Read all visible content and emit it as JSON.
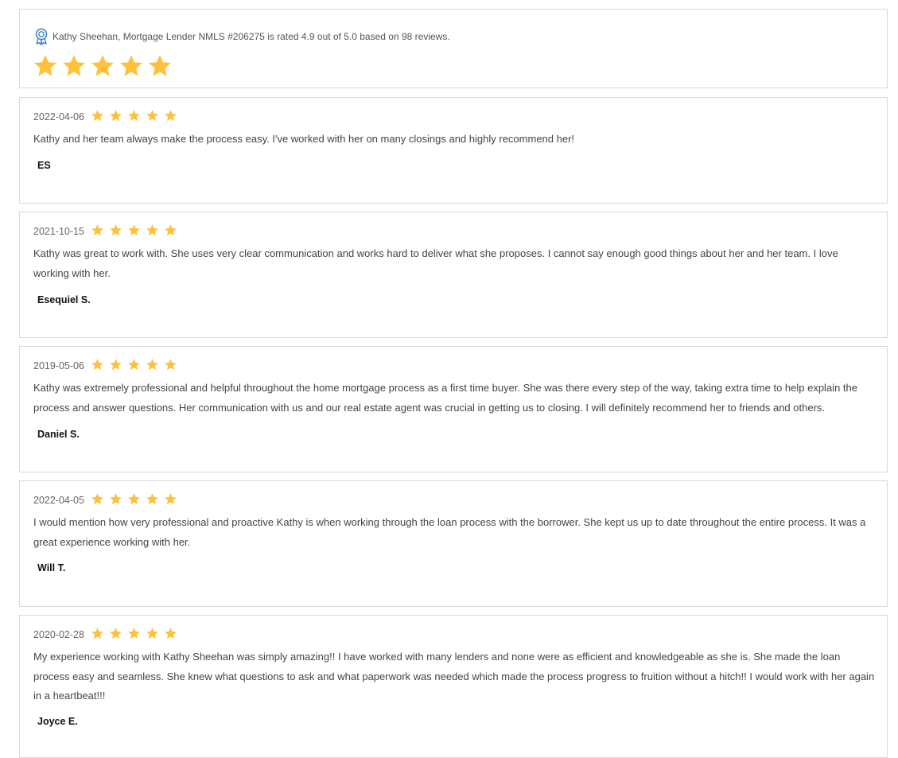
{
  "summary": {
    "text": "Kathy Sheehan, Mortgage Lender NMLS #206275 is rated 4.9 out of 5.0 based on 98 reviews.",
    "stars": 5,
    "icon": "award-ribbon-icon"
  },
  "colors": {
    "star": "#ffc13b",
    "icon": "#2f7fc9",
    "border": "#d9d9d9"
  },
  "reviews": [
    {
      "date": "2022-04-06",
      "rating": 5,
      "text": "Kathy and her team always make the process easy. I've worked with her on many closings and highly recommend her!",
      "author": "ES"
    },
    {
      "date": "2021-10-15",
      "rating": 5,
      "text": "Kathy was great to work with. She uses very clear communication and works hard to deliver what she proposes. I cannot say enough good things about her and her team. I love working with her.",
      "author": "Esequiel S."
    },
    {
      "date": "2019-05-06",
      "rating": 5,
      "text": "Kathy was extremely professional and helpful throughout the home mortgage process as a first time buyer. She was there every step of the way, taking extra time to help explain the process and answer questions. Her communication with us and our real estate agent was crucial in getting us to closing. I will definitely recommend her to friends and others.",
      "author": "Daniel S."
    },
    {
      "date": "2022-04-05",
      "rating": 5,
      "text": "I would mention how very professional and proactive Kathy is when working through the loan process with the borrower. She kept us up to date throughout the entire process. It was a great experience working with her.",
      "author": "Will T."
    },
    {
      "date": "2020-02-28",
      "rating": 5,
      "text": "My experience working with Kathy Sheehan was simply amazing!! I have worked with many lenders and none were as efficient and knowledgeable as she is. She made the loan process easy and seamless. She knew what questions to ask and what paperwork was needed which made the process progress to fruition without a hitch!! I would work with her again in a heartbeat!!!",
      "author": "Joyce E."
    }
  ]
}
